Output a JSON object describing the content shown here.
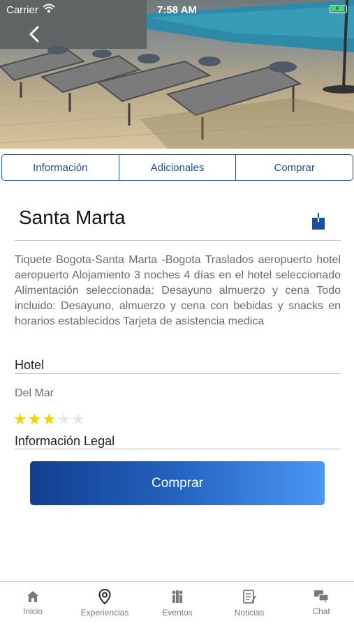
{
  "status_bar": {
    "carrier": "Carrier",
    "time": "7:58 AM"
  },
  "tabs": [
    {
      "label": "Información"
    },
    {
      "label": "Adicionales"
    },
    {
      "label": "Comprar"
    }
  ],
  "detail": {
    "title": "Santa Marta",
    "description": "Tiquete Bogota-Santa Marta -Bogota Traslados aeropuerto hotel aeropuerto Alojamiento 3 noches 4 días en el hotel seleccionado Alimentación seleccionada: Desayuno almuerzo y cena Todo incluido: Desayuno, almuerzo y cena con bebidas y snacks en horarios establecidos Tarjeta de asistencia medica",
    "hotel_heading": "Hotel",
    "hotel_name": "Del Mar",
    "rating": 3,
    "rating_max": 5,
    "legal_heading": "Información Legal",
    "buy_label": "Comprar"
  },
  "tab_bar": [
    {
      "label": "Inicio",
      "icon": "home-icon"
    },
    {
      "label": "Experiencias",
      "icon": "location-pin-icon"
    },
    {
      "label": "Eventos",
      "icon": "people-icon"
    },
    {
      "label": "Noticias",
      "icon": "news-icon"
    },
    {
      "label": "Chat",
      "icon": "chat-icon"
    }
  ],
  "colors": {
    "accent": "#1e4f9e",
    "star_on": "#f5d000",
    "star_off": "#e6e6e6"
  }
}
